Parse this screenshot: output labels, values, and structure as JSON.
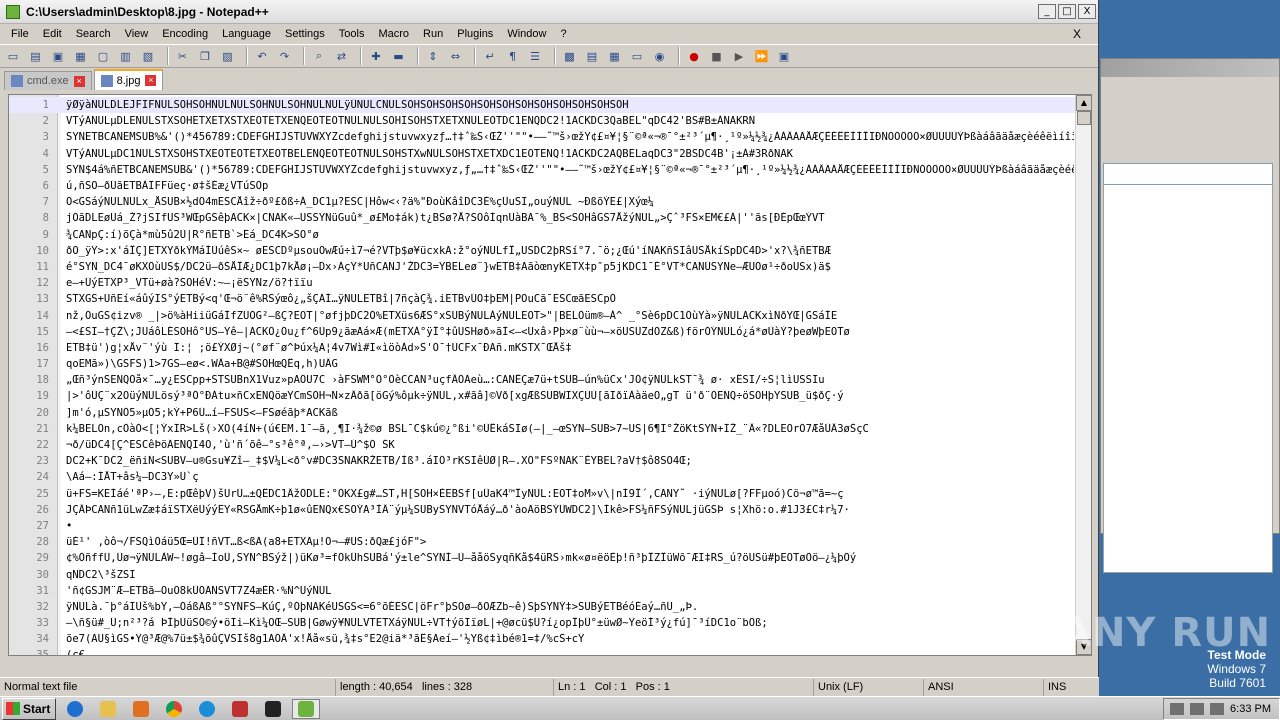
{
  "window": {
    "title": "C:\\Users\\admin\\Desktop\\8.jpg - Notepad++",
    "minimize": "_",
    "maximize": "□",
    "close": "X"
  },
  "menu": [
    "File",
    "Edit",
    "Search",
    "View",
    "Encoding",
    "Language",
    "Settings",
    "Tools",
    "Macro",
    "Run",
    "Plugins",
    "Window",
    "?"
  ],
  "menu_close": "X",
  "tabs": [
    {
      "label": "cmd.exe",
      "active": false
    },
    {
      "label": "8.jpg",
      "active": true
    }
  ],
  "editor": {
    "lines": [
      {
        "n": "1",
        "text": "ÿØÿàNULDLEJFIFNULSOHSOHNULNULSOHNULSOHNULNULÿÛNULCNULSOHSOHSOHSOHSOHSOHSOHSOHSOHSOHSOHSOH"
      },
      {
        "n": "2",
        "text": "VTýÄNULµDLENULSTXSOHETXETXSTXEOTETXENQEOTEOTNULNULSOHISOHSTXETXNULEOTDC1ENQDC2!1ACKDC3QaBEL\"qDC42'BS#B±ÁNAKRÑ"
      },
      {
        "n": "3",
        "text": "SYNETBCANEMSUB%&'()*456789:CDEFGHIJSTUVWXYZcdefghijstuvwxyzƒ…†‡ˆ‰Š‹ŒŽ''\"\"•–—˜™š›œžŸ¢£¤¥¦§¨©ª«¬­®¯°±²³´µ¶·¸¹º»¼½¾¿ÀÁÂÃÄÅÆÇÈÉÊËÌÍÎÏÐÑÒÓÔÕÖ×ØÙÚÛÜÝÞßàáâãäåæçèéêëìíîïð"
      },
      {
        "n": "4",
        "text": "VTýÄNULµDC1NULSTXSOHSTXEOTEOTETXEOTBELENQEOTEOTNULSOHSTXwNULSOHSTXETXDC1EOTENQ!1ACKDC2AQBELaqDC3\"2BSDC4B'¡±Á#3RðNAK"
      },
      {
        "n": "5",
        "text": "SYN$4á%ñETBCANEMSUB&'()*56789:CDEFGHIJSTUVWXYZcdefghijstuvwxyz‚ƒ„…†‡ˆ‰Š‹ŒŽ''\"\"•–—˜™š›œžŸ¢£¤¥¦§¨©ª«¬­®¯°±²³´µ¶·¸¹º»¼½¾¿ÀÁÂÃÄÅÆÇÈÉÊËÌÍÎÏÐÑÒÓÔÕÖ×ØÙÚÛÜÝÞßàáâãäåæçèéêëì"
      },
      {
        "n": "6",
        "text": "ú,ñSO–ðÜãETBÀÏFFüeç·ø‡šÈæ¿VTúSOp"
      },
      {
        "n": "7",
        "text": "Ó<GSáýNULNULx_ÅSUB×½dÕ4mESCÅîž÷ðº£ðß÷Á_DC1µ?ESC|Hôw<‹?ä%\"ÐoùKâîDC3É%çÜuSI„ouýNUL ~ÐßõÝE£|Xýœ¼"
      },
      {
        "n": "8",
        "text": "jÓãDLEøÜá_Ž?jSIfUS³WŒpGSêþACK×|CNAK«–USSYNüGuû*_ø£Mo‡ák)t¿BSø?Å?SOôÍqnÜàBÃ¯%_BS<SOHâGS7ÅžýNUL„>Çˆ³FS×EM€£À|''ãs[ÐÈpŒœÝVT"
      },
      {
        "n": "9",
        "text": "¾CANpÇ:í)õÇà*mù5û2Ù|R°ñETB`>Ëá_DC4K>SO°ø"
      },
      {
        "n": "10",
        "text": "ðÕ_ÿŸ>:x'áÎÇ]ETXYðkÝMáÍÙúêS×~ øESCDºµsouÖwÆú÷ì7¬é?VTþ$ø¥ücxkÃ:ž°oýNULfÎ„USDC2þRSí°7.¯ö;¿Œú'íNAKñSIâUSÅkíŠpDC4D>'x?\\¾ñETBÆ"
      },
      {
        "n": "11",
        "text": "é°SYN_DC4¯øKXÖùUS$/DC2ü–ðŠÅÎÆ¿DC1þ7kÅø¡—Dx›ÃçŸ*UñCANJ'ŽDC3=ŸBELeø¨}wETB‡ÃãòœnyKETX‡p″p5jKDC1¯É°VT*CANÚSYNe–ÆUOø¹÷ðoUSx)ä$"
      },
      {
        "n": "12",
        "text": "e–+ÛýETXP³_VTü+øà?SOHéV:~–¡ëSYNz/ö?†ïïu"
      },
      {
        "n": "13",
        "text": "STXGS+UñEí«áûýIS°ýETBý<q'Œ¬ö¨ê%RSýœô¿„šÇÄÍ…ÿNULETBî|7ñçàÇ¾.iETBvÚO‡þEM|PÕuCã¯ESCœãESCpÒ"
      },
      {
        "n": "14",
        "text": "nž,ÕuGS¢izv® _|>ö%àHiiüGáÌfZÚÓG²–ßÇ?EOT|°øfjþDC2Ó%ETXüs6ÆS°xSUBýNULÁýNULEOT>\"|BELÖüm®–Á^ _°Sè6pDC1ÕùYà»ÿNULACKxìNðŸŒ|GSáÍE"
      },
      {
        "n": "15",
        "text": "–<£SI–†ÇŽ\\;JUáôLÈSOHô°US–Ÿê–|ACKÖ¿Óu¿f^6Ùp9¿ãæÃá×Æ(mETXÀ°ÿÎ°‡ûUSHøð»ãÍ<–<Üxâ›Pþ×ø¨ùù¬–×öUSÜZdÖZ&ß)förÓÝNULó¿á*øÙàÝ?þeøWþEOTø"
      },
      {
        "n": "16",
        "text": "   ETB‡ü')g¦xÅv¨'ýù  Ï:¦ ;ö£ÝXØj~(°øf¨ø^Þúx¼A¦4v7Wì#I«ìöòÀd»Ŝ'Ö¯†ÜCFx¯ÐÃñ.mKSTX¯ŒÅš‡"
      },
      {
        "n": "17",
        "text": "qoEMã»)\\GSFS)1>7GS–eø<.WÂa+B@#SOHœQÊq,h)UÂG"
      },
      {
        "n": "18",
        "text": "„Œñ³ýnSENQÕå×¯…y¿ESCpp+STSUBnX1Vuz»pÃÔU7C  ›àFSWM°Ò°ÔèCCAN³uçfÂÔÄeù…:CANÊÇæ7ü+tSUB–ún%üCx'JÓ¢ÿNULkST¯¾  ø· xÊSI/÷S¦lìUSSIu"
      },
      {
        "n": "19",
        "text": "|>'ôÜÇ¨x2OüýNULösý³ªÔ°ÐÁtu×ñCxENQöæŸCmSOH¬N×zÂðã[öGý%ôµk÷ÿNUL,x#ãâ]©Vð[xgÆßSUBWIXÇÙÙ[ãIðïÀàäeÕ„gT ü'ð¨ÖENQ÷öSOHþŸSUB_ü$ðÇ·ý"
      },
      {
        "n": "20",
        "text": "]m'ó,µSYNÓ5»µÓ5;kÝ+P6Ü…í–FSUS<–FSøéãþ*ACKãß"
      },
      {
        "n": "21",
        "text": "k¼BELÕn,cÒàÓ<[¦ÝxÏR>Lš(›XÓ(4íN+(ú€EM.1¯–ã,¸¶I·¾ž©ø BSL¯C$kú©¿°ßi'©ÜÊkáSIø(–|_–œSYN–SUB>7~US|6¶I°ŽöKtSYN+ÏŽ_¨Â«?DLEOrÓ7ÆåÛÂ3øŠçC"
      },
      {
        "n": "22",
        "text": "¬ð/üDC4[Ç^ESCêÞöÄENQI4O,'ù'ñ´õê–°s³ê°ª,–›>VT–Ú^$Õ ŠK"
      },
      {
        "n": "23",
        "text": "DC2+K¯DC2_ëñiÑ<SUBV–u®Gsu¥Zî–_‡$V¼L<ð°v#DC3SNAKRŽETB/Ìß³.áIÖ³rKSIêÚØ|R–.XÕ\"FSºNAK¨ÈYBEL?aV†$ô8SO4Œ;"
      },
      {
        "n": "24",
        "text": "\\Aá–:ÍÅT+âs¼–DC3Y»Ú`ç"
      },
      {
        "n": "25",
        "text": "ü+FS=KEÍáé'ªP›—,E:pŒêþV)šUrÜ…±QÊDC1ÂžÖDLE:°ÒKX£g#…ST,H[SOH×ÈEBSf[uÛaK4™ÎyNUL:EOT‡oM»v\\|nÌ9Î´,CANY˜ ·iýNULø[?FFµoó)Cö¬ø™ã=~ç"
      },
      {
        "n": "26",
        "text": "JÇÂÞCANñ1üLwZæ‡áïSTXëÜýýËY«RSGÅmK÷þ1ø«ûENQx€SOÝA³ÌÂ¨ýµ¼SUBySYNVTóÅáý…ð'àoÃöBSÝÜWDC2]\\Ìkê>FS¼ñFSýNULjüGSÞ s¦Xhö:o.#1J3£C‡r¼7·"
      },
      {
        "n": "27",
        "text": "•"
      },
      {
        "n": "28",
        "text": "üÉ¹'     ,òô¬/FSQìÕáü5Œ=ÜÏ!ñVT…ß<ßÃ(a8+ETXÃµ!O¬–#US:ðQæ£jóF\">"
      },
      {
        "n": "29",
        "text": "¢%ÓñffÛ,Üø¬ÿNULÀW~!øgâ–ÌoÛ,SYN^BSýž|)üKø³=fÖkÛhSUBá'ý±le^SYNÍ–Ù–ååöSyqñKå$4üRS›mk«ø¤ëöÈþ!ñ³þÎZÎüWõ¯ÆI‡RS_ú?öUSü#þEOTøÕö–¿¼þÕý"
      },
      {
        "n": "30",
        "text": "qNDC2\\³šZSI"
      },
      {
        "n": "31",
        "text": "'ñ¢GSJM¨Æ–ETBã–ÕuÕ8kÚÕÃÑSVT7Z4æÈR·%Ñ^ÜýNUL"
      },
      {
        "n": "32",
        "text": "ÿNULà.¯þ°áÏÜš%bŸ,–ÓáßÃß°°SYNFS–KúÇ,ºÓþNAKéUSGS<=6°õÉESC|öFr°þSOø–ðOÆZb~ê)SþSYNÝ‡>SUBýETBéóÉaý…ñÜ_„Þ."
      },
      {
        "n": "33",
        "text": "–\\ñ§ü#_Ü;n²³?á ÞÍþÙüSO©ý•öÏi–Kì¼OŒ–SUB|Gøwÿ¥NULVTETXáÿNUL÷VT†ýõÏïøL|+@øcü$Û?í¿opÎþÛ°±üwØ~ŸeöÍ³ý¿fú]¯³íDC1o¨bÖß;"
      },
      {
        "n": "34",
        "text": "õe7(AU§ìGS•Ÿ@³Æ@%7ü±$¾õûÇVSIš8g1ÃÓÂ'x!Åå«sü,¾‡s°Ë2@iä*³ãÊ§Äeí–'½Yß¢‡ìbé®1=‡/%cŠ+cŸ"
      },
      {
        "n": "35",
        "text": "(c€"
      }
    ]
  },
  "status": {
    "type": "Normal text file",
    "length": "length : 40,654",
    "lines": "lines : 328",
    "ln": "Ln : 1",
    "col": "Col : 1",
    "pos": "Pos : 1",
    "eol": "Unix (LF)",
    "encoding": "ANSI",
    "mode": "INS"
  },
  "taskbar": {
    "start_label": "Start",
    "clock": "6:33 PM"
  },
  "overlay": {
    "watermark": "ANY RUN",
    "test_mode": "Test Mode",
    "os": "Windows 7",
    "build": "Build 7601"
  }
}
